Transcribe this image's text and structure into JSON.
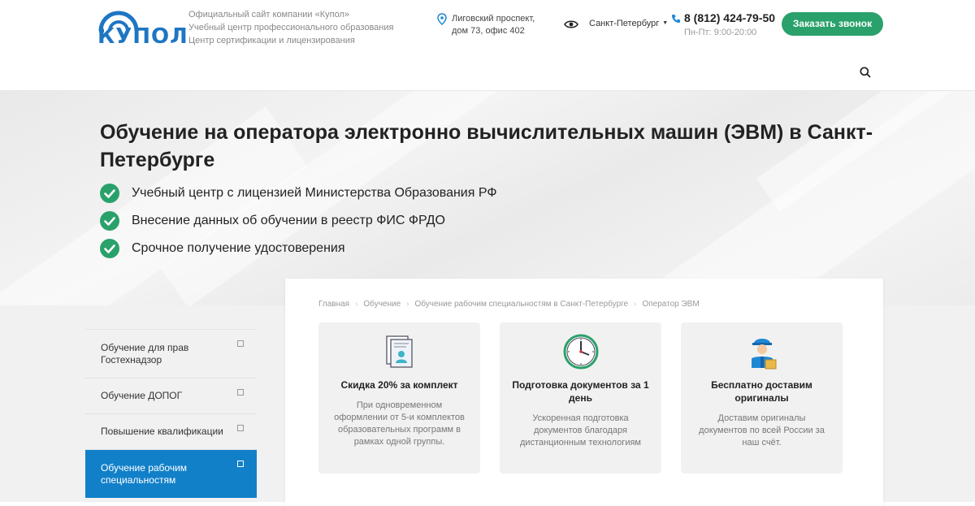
{
  "header": {
    "logo_text": "КУПОЛ",
    "tagline": [
      "Официальный сайт компании «Купол»",
      "Учебный центр профессионального образования",
      "Центр сертификации и лицензирования"
    ],
    "address": [
      "Лиговский проспект,",
      "дом 73, офис 402"
    ],
    "city": "Санкт-Петербург",
    "phone": "8 (812) 424-79-50",
    "hours": "Пн-Пт: 9:00-20:00",
    "callback_label": "Заказать звонок",
    "colors": {
      "brand": "#1e76c2",
      "accent_green": "#2aa16b"
    }
  },
  "hero": {
    "title": "Обучение на оператора электронно вычислительных машин (ЭВМ) в Санкт-Петербурге",
    "features": [
      "Учебный центр с лицензией Министерства Образования РФ",
      "Внесение данных об обучении в реестр ФИС ФРДО",
      "Срочное получение удостоверения"
    ]
  },
  "sidebar": {
    "items": [
      {
        "label": "Обучение для прав Гостехнадзор"
      },
      {
        "label": "Обучение ДОПОГ"
      },
      {
        "label": "Повышение квалификации"
      },
      {
        "label": "Обучение рабочим специальностям",
        "active": true
      }
    ]
  },
  "breadcrumb": [
    "Главная",
    "Обучение",
    "Обучение рабочим специальностям в Санкт-Петербурге",
    "Оператор ЭВМ"
  ],
  "cards": [
    {
      "icon": "document-user-icon",
      "title": "Скидка 20% за комплект",
      "text": "При одновременном оформлении от 5-и комплектов образовательных программ в рамках одной группы."
    },
    {
      "icon": "clock-icon",
      "title": "Подготовка документов за 1 день",
      "text": "Ускоренная подготовка документов благодаря дистанционным технологиям"
    },
    {
      "icon": "courier-icon",
      "title": "Бесплатно доставим оригиналы",
      "text": "Доставим оригиналы документов по всей России за наш счёт."
    }
  ]
}
